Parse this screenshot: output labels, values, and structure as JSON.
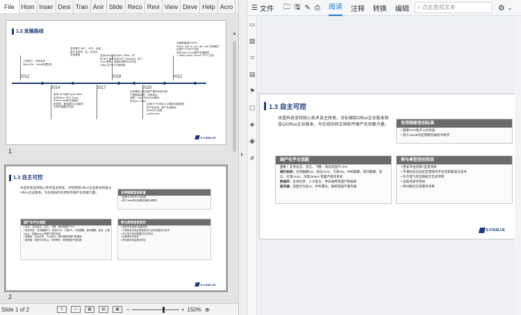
{
  "ribbon": {
    "tabs": [
      "File",
      "Hom",
      "Inser",
      "Desi",
      "Tran",
      "Anir",
      "Slide",
      "Reco",
      "Revi",
      "View",
      "Deve",
      "Help",
      "Acro"
    ],
    "more": "…"
  },
  "slide1": {
    "page_number": "1",
    "title": "1.2 发展路线",
    "years": [
      "2012",
      "2014",
      "2017",
      "2018",
      "2020",
      "2022"
    ],
    "notes": [
      [
        "公司成立，同年发布",
        "Spire.Doc、Word处理控件"
      ],
      [
        "发布.NET版本Spire.Office,",
        "支持Word, PDF, Excel,",
        "PowerPoint等文档格式",
        "的处理，囊括国内以及国外",
        "市场完整解决方案"
      ],
      [
        "发布基于.NET，SPS，全部",
        "类产品发布，且，在后台",
        "支持使用"
      ],
      [
        "支持Java 版本Spire. Office，同",
        "时.NET 版本支持.NET Standard, .NET",
        "Core 框架，全面实现跨平台开发",
        "Office 至 PDF文档转换"
      ],
      [
        "在此基础上推出国产操作系统与国",
        "产数据库适配，完成信创",
        "适配；Java 与Android版本",
        "的Spire .Office"
      ],
      [
        "实现HTTPS和CI/CD集成与模块提",
        "供产品支持，国产化适配全",
        "jQuery.ia 加强",
        "ceblue.com"
      ],
      [
        "全面覆盖国产MIPS,",
        "Leeps, arpt, ai, uos, dpc, dpk 文档格式",
        "实现PPT与PDF互转",
        "发布Spire.Cloud国产处理服务",
        "...Office (Word / Excel / PPT) 文件"
      ]
    ],
    "logo": "E-ICEBLUE"
  },
  "slide2": {
    "page_number": "2",
    "title": "1.3 自主可控",
    "desc": "冰蓝科技坚持核心技术自主研发，对标微软Office企业版本和金山Office企业版本，为在线协同文档软件国产化贡献力量。",
    "box_xc": {
      "header": "支持国家信创标准",
      "rows": [
        "国家OFD电子公文标准",
        "基于Java8的应用服务器技术要求"
      ]
    },
    "box_cn": {
      "header": "国产化平台适配",
      "rows": [
        "芯片：支持龙芯、兆芯、飞腾、海光等国产CPU",
        "操作系统：支持麒麟OS、统信UOS、方德OS、中标麒麟、银河麒麟、统信、红旗Linux、深度deepin 等国产操作系统",
        "数据库：支持达梦、人大金仓、神舟通用等国产数据库",
        "服务器：适配华为泰山、中科曙光、联想等国产服务器"
      ]
    },
    "box_pr": {
      "header": "参与典型信创项目",
      "rows": [
        "西安市住房网+监管项目",
        "平潭综合实验区智慧政务平台项目集成与技术",
        "东方电气综合数据交互式项目",
        "远程考录手系统",
        "神州数码信息服务项目"
      ]
    },
    "logo": "E-ICEBLUE"
  },
  "status": {
    "slide_of": "Slide 1 of 2",
    "zoom": "150%",
    "zoom_fraction": 0.65
  },
  "reader": {
    "toolbar": {
      "file": "文件",
      "tabs": [
        "阅读",
        "注释",
        "转换",
        "编辑"
      ],
      "active_tab": "阅读",
      "search_placeholder": "点此查找文本"
    },
    "page": {
      "title": "1.3 自主可控",
      "desc": "冰蓝科技坚持核心技术自主研发，对标微软Office企业版本和金山Office企业版本，为在线协同文档软件国产化贡献力量。",
      "box_xc": {
        "header": "支持国家信创标准",
        "rows": [
          "国家OFD电子公文标准",
          "基于Java8的应用服务器技术要求"
        ]
      },
      "box_cn": {
        "header": "国产化平台适配",
        "rows": [
          {
            "k": "芯片：",
            "v": "支持龙芯、兆芯、飞腾、海光等国产CPU"
          },
          {
            "k": "操作系统：",
            "v": "支持麒麟OS、统信UOS、方德OS、中标麒麟、银河麒麟、统"
          },
          {
            "k": "",
            "v": "信、红旗Linux、深度deepin 等国产操作系统"
          },
          {
            "k": "数据库：",
            "v": "支持达梦、人大金仓、神舟通用等国产数据库"
          },
          {
            "k": "服务器：",
            "v": "适配华为泰山、中科曙光、联想等国产服务器"
          }
        ]
      },
      "box_pr": {
        "header": "参与典型信创项目",
        "rows": [
          "西安市住房网+监管项目",
          "平潭综合实验区智慧政务平台项目集成与技术",
          "东方电气综合数据交互式项目",
          "远程考录手系统",
          "神州数码信息服务项目"
        ]
      },
      "logo": "E-ICEBLUE"
    }
  }
}
